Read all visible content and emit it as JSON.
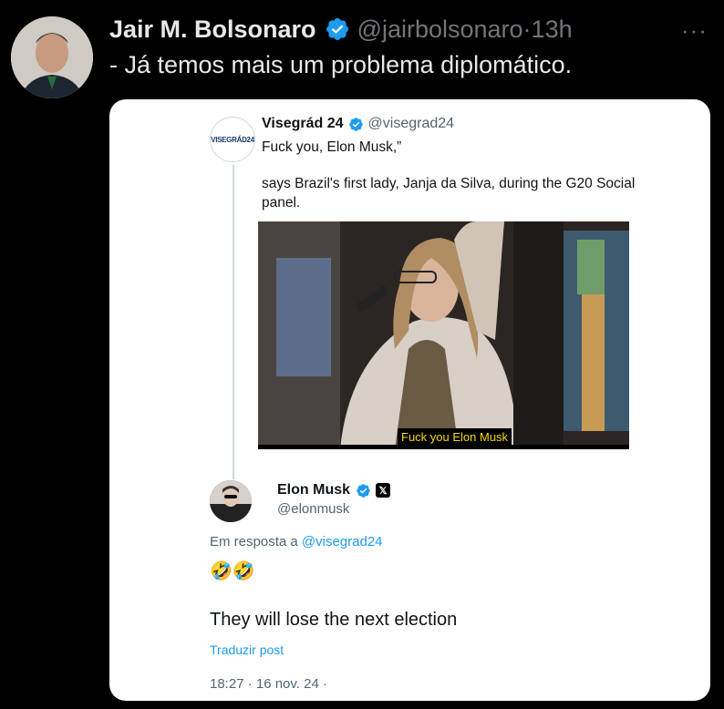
{
  "tweet": {
    "author_name": "Jair M. Bolsonaro",
    "handle": "@jairbolsonaro",
    "separator": "·",
    "time": "13h",
    "more": "···",
    "text": "- Já temos mais um problema diplomático."
  },
  "quoted": {
    "avatar_text": "VISEGRÁD24",
    "author_name": "Visegrád 24",
    "handle": "@visegrad24",
    "line1": "Fuck you, Elon Musk,”",
    "line2": "says Brazil's first lady, Janja da Silva, during the G20 Social panel.",
    "video_caption": "Fuck you Elon Musk"
  },
  "reply": {
    "author_name": "Elon Musk",
    "x_badge": "𝕏",
    "handle": "@elonmusk",
    "reply_prefix": "Em resposta a",
    "reply_to_handle": "@visegrad24",
    "emoji": "🤣🤣",
    "text": "They will lose the next election",
    "translate": "Traduzir post",
    "timestamp": "18:27 · 16 nov. 24 ·"
  },
  "colors": {
    "background": "#000000",
    "accent": "#1d9bf0",
    "muted": "#71767b"
  },
  "icons": [
    "verified-badge-icon",
    "more-options-icon",
    "x-logo-icon"
  ]
}
